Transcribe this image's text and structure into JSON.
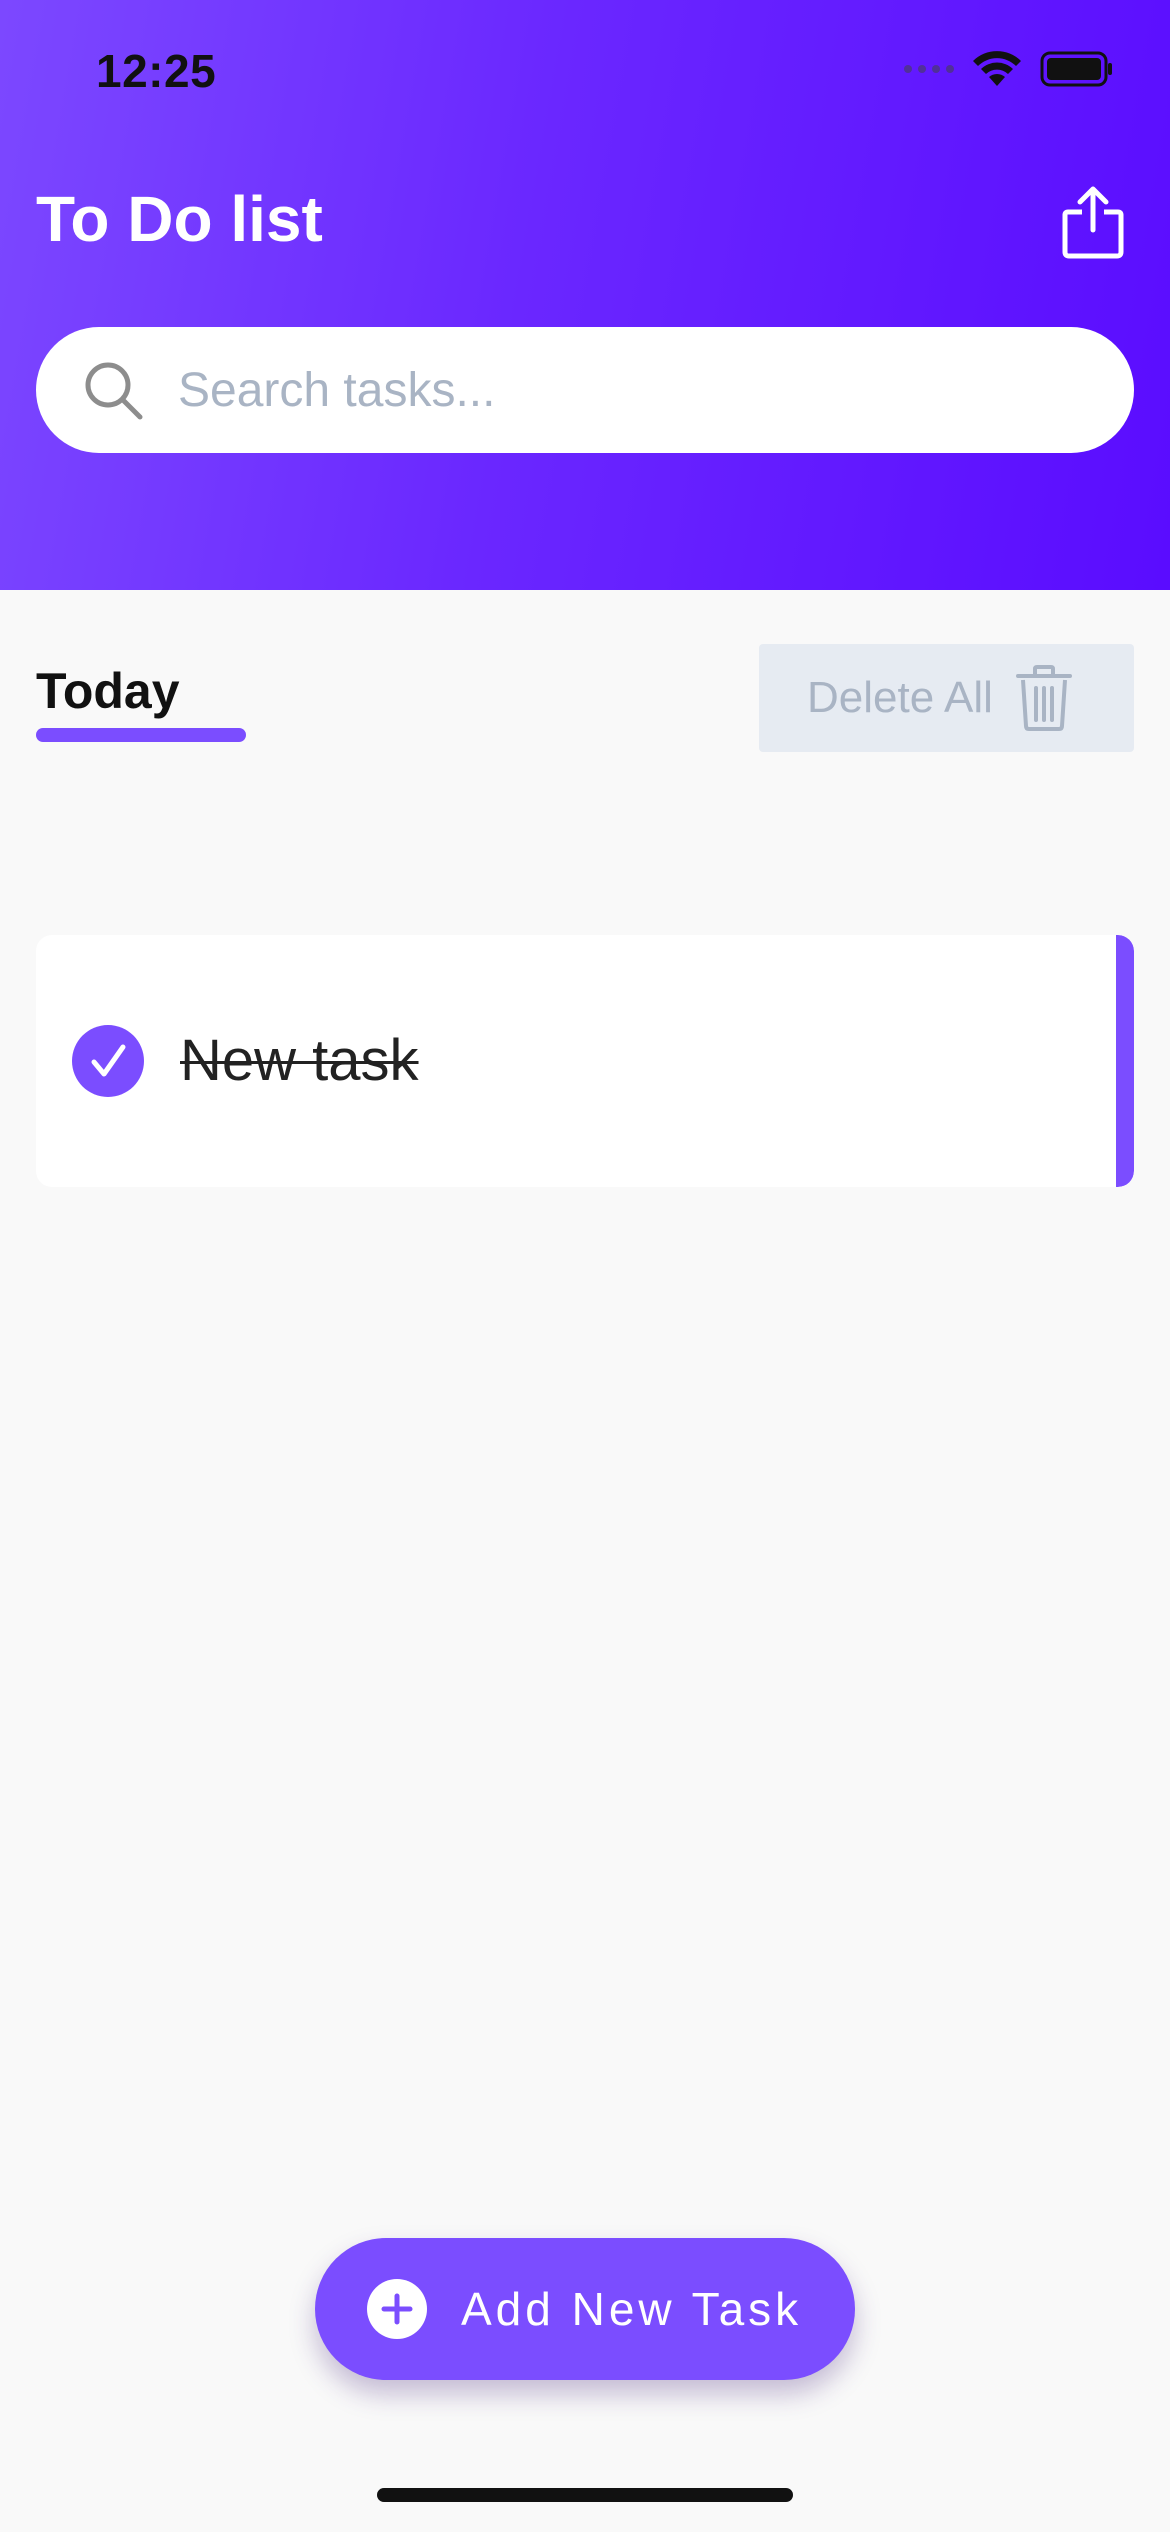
{
  "status_bar": {
    "time": "12:25",
    "icons": [
      "cellular-signal-icon",
      "wifi-icon",
      "battery-icon"
    ]
  },
  "header": {
    "title": "To Do list",
    "share_icon": "share-icon",
    "gradient": [
      "#7c48ff",
      "#5a0cff"
    ]
  },
  "search": {
    "placeholder": "Search tasks...",
    "value": "",
    "icon": "search-icon"
  },
  "section": {
    "tab_label": "Today",
    "delete_all_label": "Delete All",
    "delete_icon": "trash-icon"
  },
  "tasks": [
    {
      "title": "New task",
      "completed": true
    }
  ],
  "add_button": {
    "label": "Add New Task",
    "icon": "plus-icon"
  },
  "colors": {
    "accent": "#7b4dff",
    "background": "#f9f9f9",
    "muted_text": "#a9b4c4"
  }
}
